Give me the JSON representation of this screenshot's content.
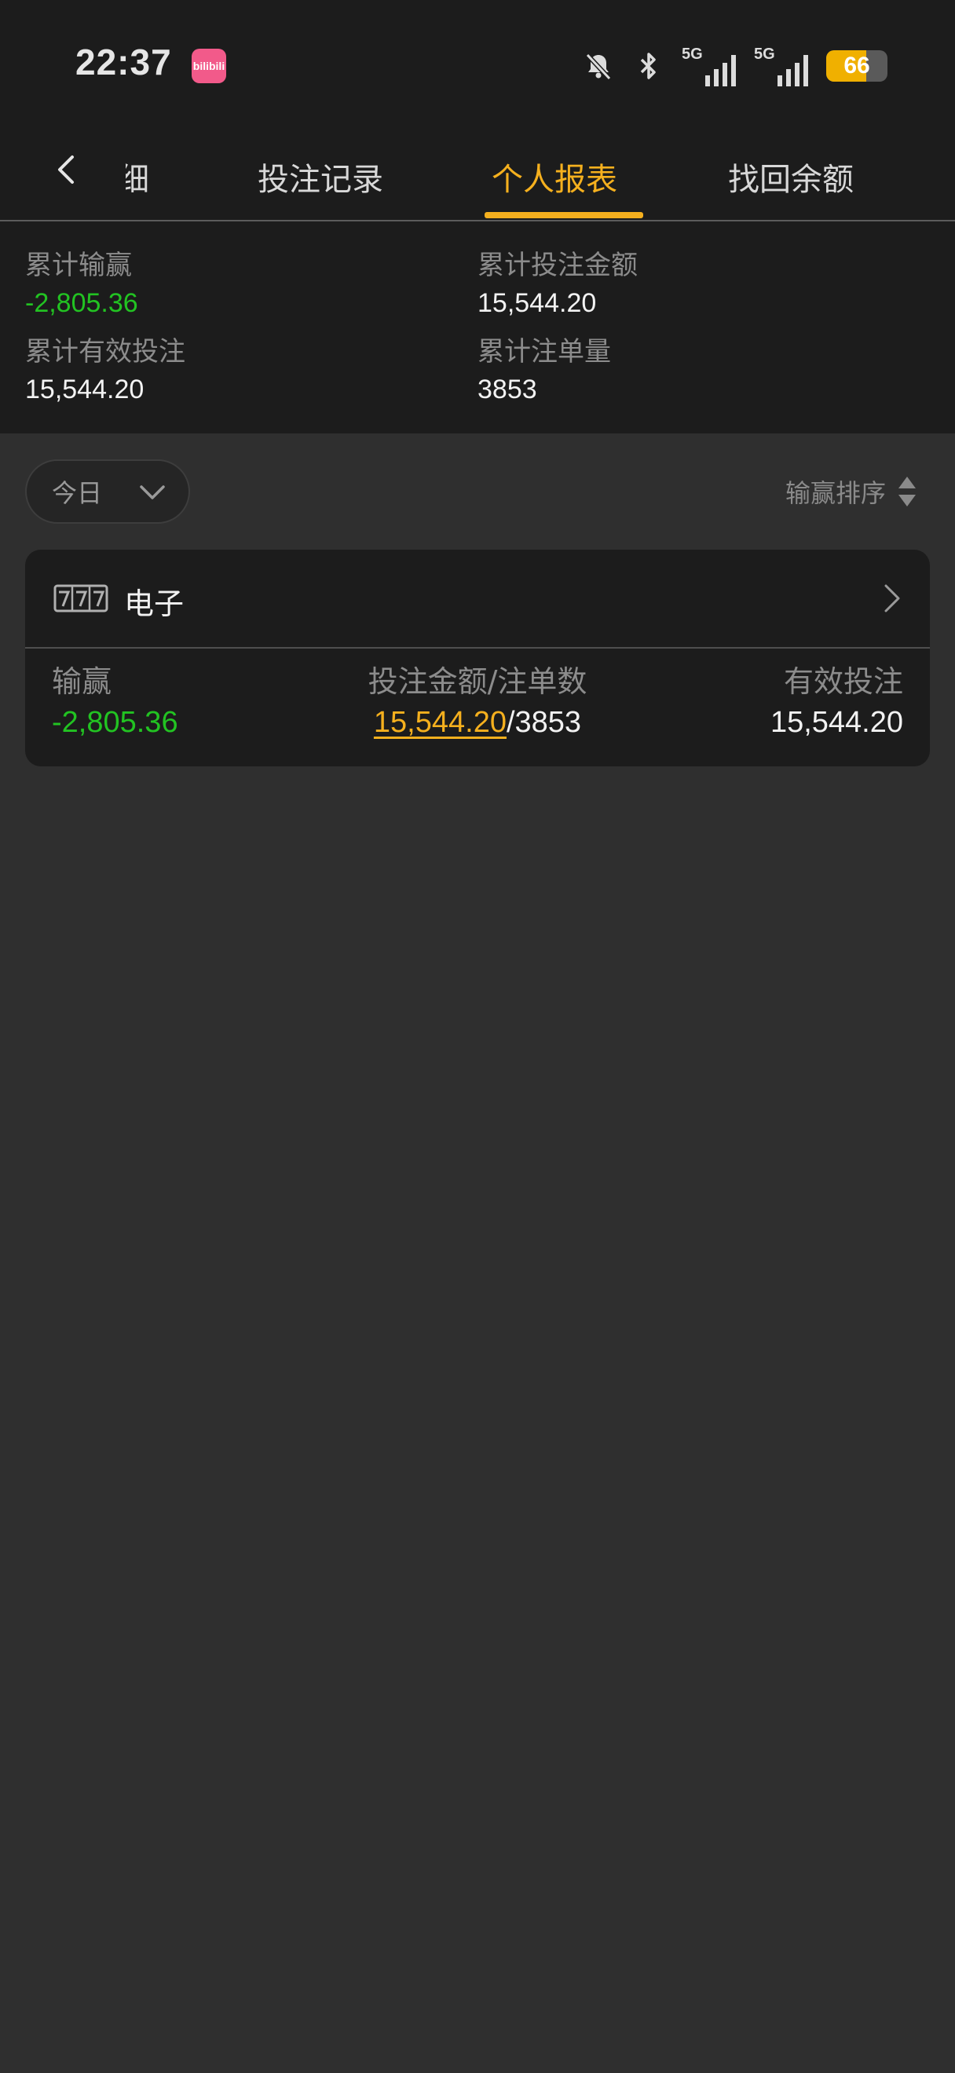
{
  "status_bar": {
    "time": "22:37",
    "app_icon_label": "bilibili",
    "signal_1_label": "5G",
    "signal_2_label": "5G",
    "battery_percent": "66",
    "battery_level": 0.66
  },
  "tabs": {
    "partial_label": "明细",
    "items": [
      {
        "label": "投注记录"
      },
      {
        "label": "个人报表"
      },
      {
        "label": "找回余额"
      }
    ],
    "active_index": 1,
    "accent_color": "#f5b01e"
  },
  "summary": {
    "total_win_loss": {
      "label": "累计输赢",
      "value": "-2,805.36"
    },
    "total_bet_amount": {
      "label": "累计投注金额",
      "value": "15,544.20"
    },
    "total_valid_bet": {
      "label": "累计有效投注",
      "value": "15,544.20"
    },
    "total_bet_count": {
      "label": "累计注单量",
      "value": "3853"
    }
  },
  "filter": {
    "selected": "今日",
    "sort_label": "输赢排序"
  },
  "categories": [
    {
      "title": "电子",
      "icon": "slot-machine-777-icon",
      "win_loss_label": "输赢",
      "win_loss_value": "-2,805.36",
      "bet_label": "投注金额/注单数",
      "bet_amount": "15,544.20",
      "bet_separator": "/",
      "bet_count": "3853",
      "valid_bet_label": "有效投注",
      "valid_bet_value": "15,544.20"
    }
  ],
  "colors": {
    "negative_value": "#22c322",
    "background": "#2f2f2f",
    "panel": "#1c1c1c"
  }
}
